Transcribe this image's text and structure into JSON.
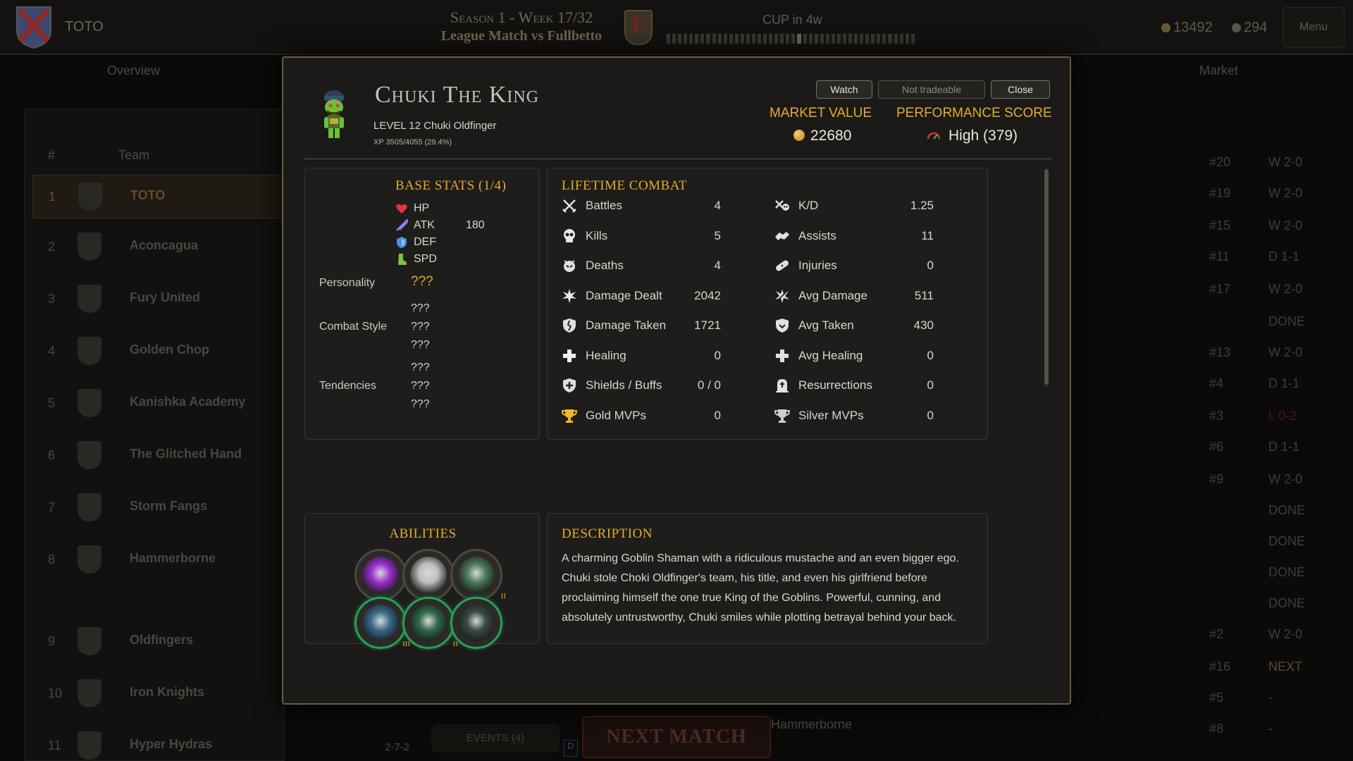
{
  "app": {
    "team_name": "TOTO",
    "season_line": "Season 1 - Week 17/32",
    "match_line": "League Match vs Fullbetto",
    "opponent_crest_letter": "F",
    "cup_label": "CUP in 4w",
    "week_progress": 0.53,
    "gold": "13492",
    "gems": "294",
    "menu_label": "Menu",
    "tabs": [
      "Overview",
      "Market"
    ]
  },
  "standings": {
    "headers": {
      "rank": "#",
      "team": "Team"
    },
    "rows": [
      {
        "rank": "1",
        "name": "TOTO",
        "selected": true
      },
      {
        "rank": "2",
        "name": "Aconcagua"
      },
      {
        "rank": "3",
        "name": "Fury United"
      },
      {
        "rank": "4",
        "name": "Golden Chop"
      },
      {
        "rank": "5",
        "name": "Kanishka Academy"
      },
      {
        "rank": "6",
        "name": "The Glitched Hand"
      },
      {
        "rank": "7",
        "name": "Storm Fangs"
      },
      {
        "rank": "8",
        "name": "Hammerborne"
      },
      {
        "rank": "9",
        "name": "Oldfingers"
      },
      {
        "rank": "10",
        "name": "Iron Knights"
      },
      {
        "rank": "11",
        "name": "Hyper Hydras",
        "score": "2-7-2"
      }
    ]
  },
  "schedule_right": [
    {
      "num": "#20",
      "result": "W 2-0"
    },
    {
      "num": "#19",
      "result": "W 2-0"
    },
    {
      "num": "#15",
      "result": "W 2-0"
    },
    {
      "num": "#11",
      "result": "D 1-1"
    },
    {
      "num": "#17",
      "result": "W 2-0"
    },
    {
      "num": "",
      "result": "DONE"
    },
    {
      "num": "#13",
      "result": "W 2-0"
    },
    {
      "num": "#4",
      "result": "D 1-1"
    },
    {
      "num": "#3",
      "result": "L 0-2"
    },
    {
      "num": "#6",
      "result": "D 1-1"
    },
    {
      "num": "#9",
      "result": "W 2-0"
    },
    {
      "num": "",
      "result": "DONE"
    },
    {
      "num": "",
      "result": "DONE"
    },
    {
      "num": "",
      "result": "DONE"
    },
    {
      "num": "",
      "result": "DONE"
    },
    {
      "num": "#2",
      "result": "W 2-0"
    },
    {
      "num": "#16",
      "result": "NEXT"
    },
    {
      "num": "#5",
      "result": "-"
    },
    {
      "num": "#8",
      "result": "-"
    }
  ],
  "footer": {
    "events_label": "EVENTS (4)",
    "next_match_label": "NEXT MATCH",
    "next_opponent": "Hammerborne",
    "slot_label": "D"
  },
  "modal": {
    "name": "Chuki The King",
    "level_line": "LEVEL 12 Chuki Oldfinger",
    "xp_line": "XP 3505/4055 (29.4%)",
    "buttons": {
      "watch": "Watch",
      "tradeable": "Not tradeable",
      "close": "Close"
    },
    "market_value_title": "MARKET VALUE",
    "market_value": "22680",
    "performance_title": "PERFORMANCE SCORE",
    "performance_value": "High (379)",
    "base_stats": {
      "title": "BASE STATS (1/4)",
      "items": [
        {
          "label": "HP",
          "value": "",
          "icon": "heart-icon",
          "color": "#e0353b"
        },
        {
          "label": "ATK",
          "value": "180",
          "icon": "sword-icon",
          "color": "#8a7ef0"
        },
        {
          "label": "DEF",
          "value": "",
          "icon": "shield-icon",
          "color": "#4a90e0"
        },
        {
          "label": "SPD",
          "value": "",
          "icon": "boot-icon",
          "color": "#7ec04a"
        }
      ]
    },
    "traits": {
      "personality_label": "Personality",
      "personality": [
        "???"
      ],
      "combat_style_label": "Combat Style",
      "combat_style": [
        "???",
        "???",
        "???"
      ],
      "tendencies_label": "Tendencies",
      "tendencies": [
        "???",
        "???",
        "???"
      ]
    },
    "lifetime_combat": {
      "title": "LIFETIME COMBAT",
      "left": [
        {
          "label": "Battles",
          "value": "4",
          "icon": "crossed-swords-icon"
        },
        {
          "label": "Kills",
          "value": "5",
          "icon": "skull-icon"
        },
        {
          "label": "Deaths",
          "value": "4",
          "icon": "death-icon"
        },
        {
          "label": "Damage Dealt",
          "value": "2042",
          "icon": "burst-icon"
        },
        {
          "label": "Damage Taken",
          "value": "1721",
          "icon": "cracked-shield-icon"
        },
        {
          "label": "Healing",
          "value": "0",
          "icon": "heal-cross-icon"
        },
        {
          "label": "Shields / Buffs",
          "value": "0 / 0",
          "icon": "shield-plus-icon"
        },
        {
          "label": "Gold MVPs",
          "value": "0",
          "icon": "gold-trophy-icon"
        }
      ],
      "right": [
        {
          "label": "K/D",
          "value": "1.25",
          "icon": "kd-icon"
        },
        {
          "label": "Assists",
          "value": "11",
          "icon": "handshake-icon"
        },
        {
          "label": "Injuries",
          "value": "0",
          "icon": "bandage-icon"
        },
        {
          "label": "Avg Damage",
          "value": "511",
          "icon": "avg-damage-icon"
        },
        {
          "label": "Avg Taken",
          "value": "430",
          "icon": "avg-shield-icon"
        },
        {
          "label": "Avg Healing",
          "value": "0",
          "icon": "avg-heal-icon"
        },
        {
          "label": "Resurrections",
          "value": "0",
          "icon": "tombstone-icon"
        },
        {
          "label": "Silver MVPs",
          "value": "0",
          "icon": "silver-trophy-icon"
        }
      ]
    },
    "abilities": {
      "title": "ABILITIES",
      "items": [
        {
          "name": "purple-burst-ability-icon",
          "tier": "",
          "ring": "gray",
          "color": "#9b30d0"
        },
        {
          "name": "dash-ability-icon",
          "tier": "",
          "ring": "gray",
          "color": "#bfbfbf"
        },
        {
          "name": "goblin-squad-ability-icon",
          "tier": "II",
          "ring": "gray",
          "color": "#4a7a5a"
        },
        {
          "name": "goblin-army-ability-icon",
          "tier": "III",
          "ring": "green",
          "color": "#3a6a8a"
        },
        {
          "name": "summon-ability-icon",
          "tier": "II",
          "ring": "green",
          "color": "#2e6a4a"
        },
        {
          "name": "face-ability-icon",
          "tier": "",
          "ring": "green",
          "color": "#3a4a48"
        }
      ]
    },
    "description": {
      "title": "DESCRIPTION",
      "text": "A charming Goblin Shaman with a ridiculous mustache and an even bigger ego. Chuki stole Choki Oldfinger's team, his title, and even his girlfriend before proclaiming himself the one true King of the Goblins. Powerful, cunning, and absolutely untrustworthy, Chuki smiles while plotting betrayal behind your back."
    }
  }
}
